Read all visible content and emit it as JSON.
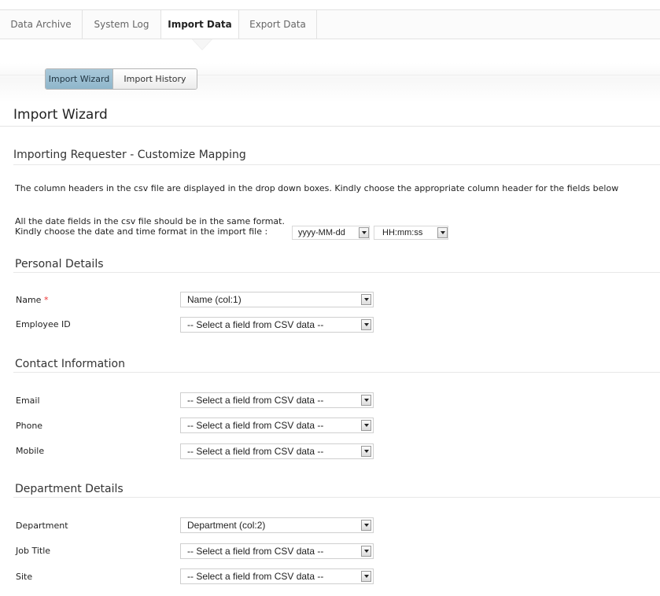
{
  "top_tabs": [
    {
      "label": "Data Archive"
    },
    {
      "label": "System Log"
    },
    {
      "label": "Import Data"
    },
    {
      "label": "Export Data"
    }
  ],
  "sub_tabs": [
    {
      "label": "Import Wizard"
    },
    {
      "label": "Import History"
    }
  ],
  "page_title": "Import Wizard",
  "subtitle": "Importing Requester - Customize Mapping",
  "instructions": {
    "line1": "The column headers in the csv file are displayed in the drop down boxes. Kindly choose the appropriate column header for the fields below",
    "line2": "All the date fields in the csv file should be in the same format.",
    "line3": "Kindly choose the date and time format in the import file :",
    "date_format": "yyyy-MM-dd",
    "time_format": "HH:mm:ss"
  },
  "sections": {
    "personal": {
      "title": "Personal Details",
      "fields": [
        {
          "label": "Name",
          "required_mark": "*",
          "value": "Name (col:1)"
        },
        {
          "label": "Employee ID",
          "value": "-- Select a field from CSV data --"
        }
      ]
    },
    "contact": {
      "title": "Contact Information",
      "fields": [
        {
          "label": "Email",
          "value": "-- Select a field from CSV data --"
        },
        {
          "label": "Phone",
          "value": "-- Select a field from CSV data --"
        },
        {
          "label": "Mobile",
          "value": "-- Select a field from CSV data --"
        }
      ]
    },
    "department": {
      "title": "Department Details",
      "fields": [
        {
          "label": "Department",
          "value": "Department (col:2)"
        },
        {
          "label": "Job Title",
          "value": "-- Select a field from CSV data --"
        },
        {
          "label": "Site",
          "value": "-- Select a field from CSV data --"
        }
      ]
    }
  }
}
